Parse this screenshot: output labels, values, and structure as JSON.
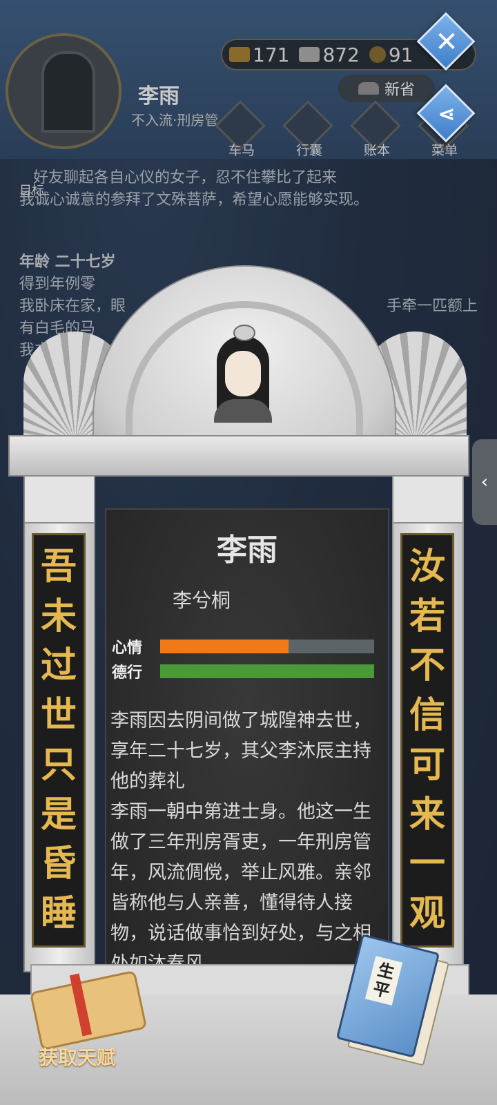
{
  "background": {
    "player_name": "李雨",
    "player_rank": "不入流·刑房管",
    "resources": [
      {
        "icon": "gold-ingot-icon",
        "value": "171"
      },
      {
        "icon": "silver-ingot-icon",
        "value": "872"
      },
      {
        "icon": "coin-icon",
        "value": "91"
      }
    ],
    "province_label": "新省",
    "menu": [
      {
        "icon": "carriage-icon",
        "label": "车马"
      },
      {
        "icon": "bag-icon",
        "label": "行囊"
      },
      {
        "icon": "ledger-icon",
        "label": "账本"
      },
      {
        "icon": "menu-icon",
        "label": "菜单"
      }
    ],
    "target_label": "目标",
    "log_lines": [
      "好友聊起各自心仪的女子，忍不住攀比了起来",
      "我诚心诚意的参拜了文殊菩萨，希望心愿能够实现。"
    ],
    "age_heading": "年龄 二十七岁",
    "age_lines": [
      "得到年例零",
      "我卧床在家，眼",
      "手牵一匹额上",
      "有白毛的马",
      "我方"
    ]
  },
  "tombstone": {
    "name": "李雨",
    "alias": "李兮桐",
    "stats": [
      {
        "label": "心情",
        "value": 0.6,
        "color": "#f07a1a"
      },
      {
        "label": "德行",
        "value": 1.0,
        "color": "#4a9a3a"
      }
    ],
    "epitaph": [
      "李雨因去阴间做了城隍神去世，享年二十七岁，其父李沐辰主持他的葬礼",
      "李雨一朝中第进士身。他这一生做了三年刑房胥吏，一年刑房管年，风流倜傥，举止风雅。亲邻皆称他与人亲善，懂得待人接物，说话做事恰到好处，与之相处如沐春风。"
    ],
    "couplet_left": [
      "吾",
      "未",
      "过",
      "世",
      "只",
      "是",
      "昏",
      "睡"
    ],
    "couplet_right": [
      "汝",
      "若",
      "不",
      "信",
      "可",
      "来",
      "一",
      "观"
    ]
  },
  "actions": {
    "talent_label": "获取天赋",
    "book_title": "生平"
  },
  "buttons": {
    "close_glyph": "✕",
    "share_glyph": "⋖",
    "side_tab_glyph": "‹"
  }
}
